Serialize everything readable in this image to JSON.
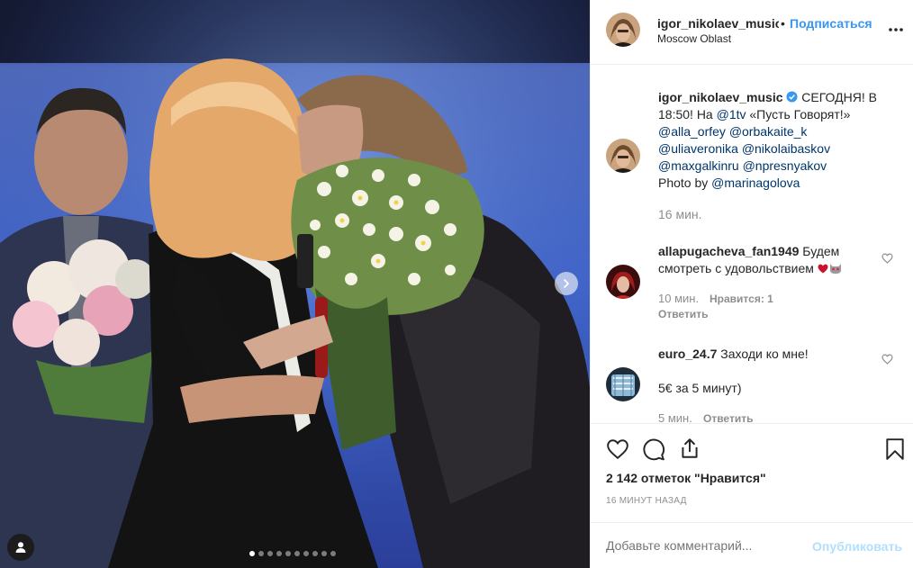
{
  "post": {
    "username": "igor_nikolaev_music",
    "bullet": "•",
    "follow_label": "Подписаться",
    "location": "Moscow Oblast",
    "more_label": "•••"
  },
  "caption": {
    "username": "igor_nikolaev_music",
    "line1_rest": " СЕГОДНЯ! В",
    "line2_pre": "18:50! На ",
    "line2_mention": "@1tv",
    "line2_post": " «Пусть Говорят!»",
    "mentions": [
      "@alla_orfey",
      "@orbakaite_k",
      "@uliaveronika",
      "@nikolaibaskov",
      "@maxgalkinru",
      "@npresnyakov"
    ],
    "photo_by_pre": "Photo by ",
    "photo_by_mention": "@marinagolova",
    "time": "16 мин."
  },
  "comments": [
    {
      "username": "allapugacheva_fan1949",
      "text_line1": " Будем",
      "text_line2": "смотреть с удовольствием ",
      "emoji": "❤️😻",
      "time": "10 мин.",
      "likes": "Нравится: 1",
      "reply": "Ответить"
    },
    {
      "username": "euro_24.7",
      "text_line1": " Заходи ко мне!",
      "text_line2": "5€ за 5 минут)",
      "time": "5 мин.",
      "reply": "Ответить"
    }
  ],
  "actions": {
    "likes_text": "2 142 отметок \"Нравится\"",
    "time_ago": "16 МИНУТ НАЗАД"
  },
  "add_comment": {
    "placeholder": "Добавьте комментарий...",
    "publish_label": "Опубликовать"
  },
  "icons": {
    "like": "heart-icon",
    "comment": "comment-icon",
    "share": "share-icon",
    "save": "bookmark-icon",
    "verified": "verified-badge-icon"
  },
  "colors": {
    "accent": "#3897f0",
    "publish_disabled": "#b2dffc",
    "link": "#003569",
    "muted": "#8e8e8e"
  },
  "carousel": {
    "total": 10,
    "active_index": 1
  }
}
